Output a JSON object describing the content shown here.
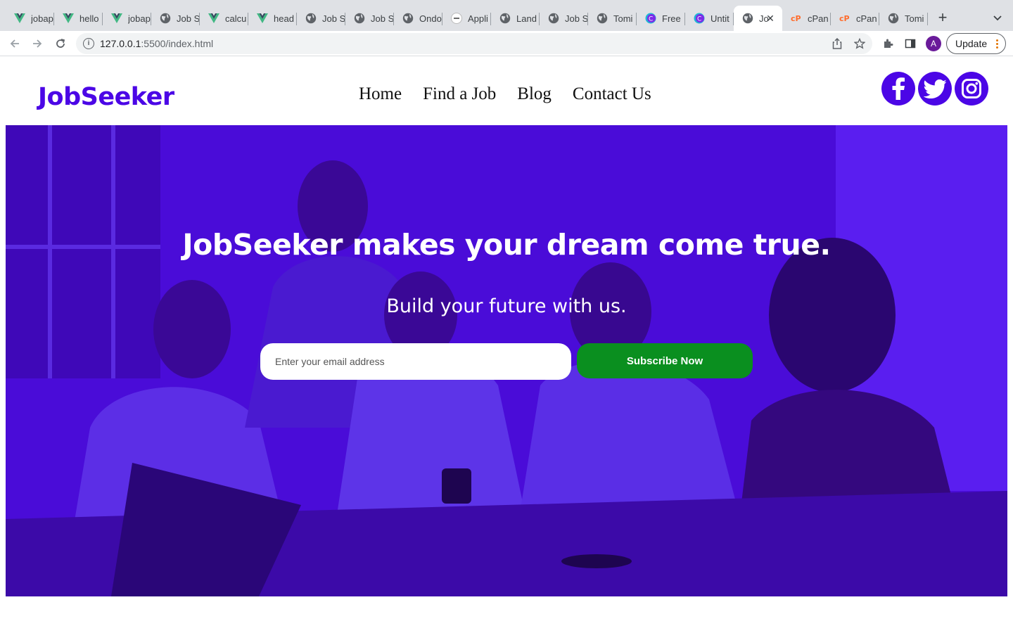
{
  "browser": {
    "tabs": [
      {
        "label": "jobap",
        "icon": "vue-icon"
      },
      {
        "label": "hello",
        "icon": "vue-icon"
      },
      {
        "label": "jobap",
        "icon": "vue-icon"
      },
      {
        "label": "Job S",
        "icon": "globe-icon"
      },
      {
        "label": "calcu",
        "icon": "vue-icon"
      },
      {
        "label": "head",
        "icon": "vue-icon"
      },
      {
        "label": "Job S",
        "icon": "globe-icon"
      },
      {
        "label": "Job S",
        "icon": "globe-icon"
      },
      {
        "label": "Ondo",
        "icon": "globe-icon"
      },
      {
        "label": "Appli",
        "icon": "app-icon"
      },
      {
        "label": "Land",
        "icon": "globe-icon"
      },
      {
        "label": "Job S",
        "icon": "globe-icon"
      },
      {
        "label": "Tomi",
        "icon": "globe-icon"
      },
      {
        "label": "Free",
        "icon": "canva-icon"
      },
      {
        "label": "Untit",
        "icon": "canva-icon"
      },
      {
        "label": "Jo",
        "icon": "globe-icon",
        "active": true
      },
      {
        "label": "cPan",
        "icon": "cpanel-icon"
      },
      {
        "label": "cPan",
        "icon": "cpanel-icon"
      },
      {
        "label": "Tomi",
        "icon": "globe-icon"
      }
    ],
    "url_host": "127.0.0.1",
    "url_rest": ":5500/index.html",
    "update_label": "Update",
    "profile_initial": "A"
  },
  "site": {
    "logo": "JobSeeker",
    "nav": {
      "home": "Home",
      "find_job": "Find a Job",
      "blog": "Blog",
      "contact": "Contact Us"
    },
    "socials": [
      "facebook-icon",
      "twitter-icon",
      "instagram-icon"
    ]
  },
  "hero": {
    "title": "JobSeeker makes your dream come true.",
    "subtitle": "Build your future with us.",
    "email_placeholder": "Enter your email address",
    "email_value": "",
    "subscribe_label": "Subscribe Now"
  },
  "colors": {
    "brand": "#4b06e6",
    "hero_overlay": "#4a0cd8",
    "subscribe": "#0a8f1f"
  }
}
